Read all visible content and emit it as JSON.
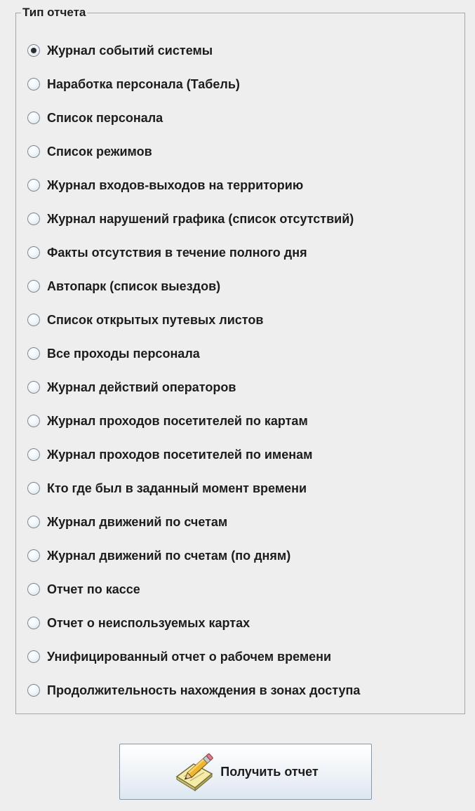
{
  "report_type_group": {
    "title": "Тип отчета",
    "selected_index": 0,
    "options": [
      "Журнал событий системы",
      "Наработка персонала (Табель)",
      "Список персонала",
      "Список режимов",
      "Журнал входов-выходов на территорию",
      "Журнал нарушений графика (список отсутствий)",
      "Факты отсутствия в течение полного дня",
      "Автопарк (список выездов)",
      "Список открытых путевых листов",
      "Все проходы персонала",
      "Журнал действий операторов",
      "Журнал проходов посетителей по картам",
      "Журнал проходов посетителей по именам",
      "Кто где был в заданный момент времени",
      "Журнал движений по счетам",
      "Журнал движений по счетам (по дням)",
      "Отчет по кассе",
      "Отчет о неиспользуемых картах",
      "Унифицированный отчет о рабочем времени",
      "Продолжительность нахождения в зонах доступа"
    ]
  },
  "actions": {
    "get_report_label": "Получить отчет",
    "get_report_icon": "notepad-pencil-icon"
  }
}
